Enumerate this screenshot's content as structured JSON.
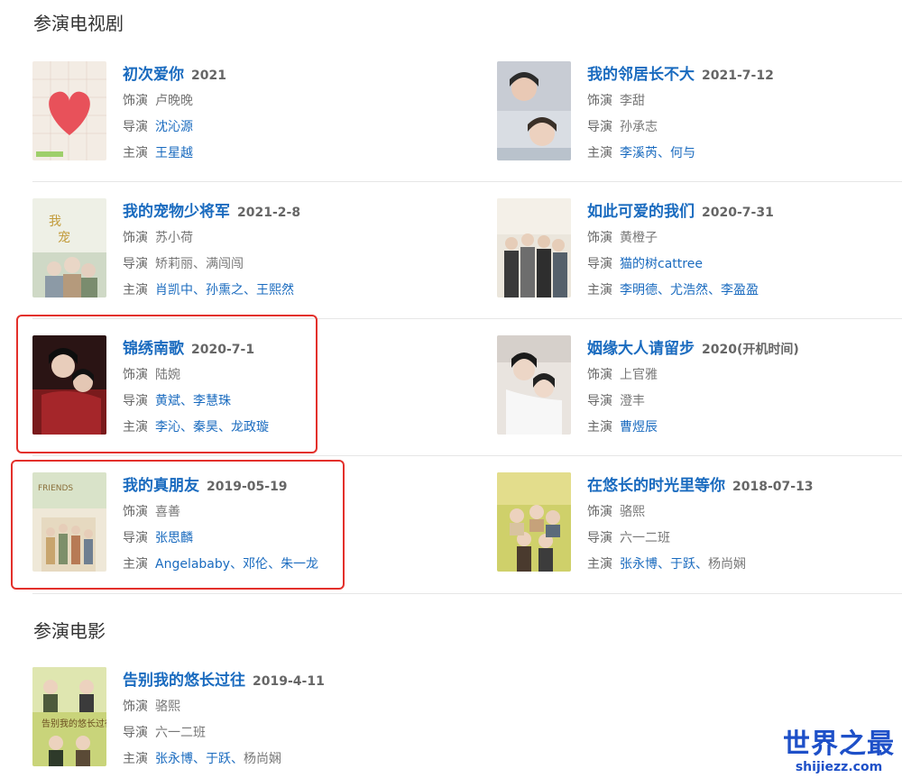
{
  "sections": {
    "tv_title": "参演电视剧",
    "movie_title": "参演电影"
  },
  "labels": {
    "role": "饰演",
    "director": "导演",
    "cast": "主演"
  },
  "tv": [
    {
      "title": "初次爱你",
      "date": "2021",
      "role": "卢晚晚",
      "director": [
        "沈沁源"
      ],
      "cast": [
        "王星越"
      ]
    },
    {
      "title": "我的邻居长不大",
      "date": "2021-7-12",
      "role": "李甜",
      "director_text": "孙承志",
      "cast": [
        "李溪芮",
        "何与"
      ]
    },
    {
      "title": "我的宠物少将军",
      "date": "2021-2-8",
      "role": "苏小荷",
      "director_text": "矫莉丽、满闯闯",
      "cast": [
        "肖凯中",
        "孙熏之",
        "王熙然"
      ]
    },
    {
      "title": "如此可爱的我们",
      "date": "2020-7-31",
      "role": "黄橙子",
      "director": [
        "猫的树cattree"
      ],
      "cast": [
        "李明德",
        "尤浩然",
        "李盈盈"
      ]
    },
    {
      "title": "锦绣南歌",
      "date": "2020-7-1",
      "role": "陆婉",
      "director": [
        "黄斌",
        "李慧珠"
      ],
      "cast": [
        "李沁",
        "秦昊",
        "龙政璇"
      ]
    },
    {
      "title": "姻缘大人请留步",
      "date": "2020(开机时间)",
      "role": "上官雅",
      "director_text": "澄丰",
      "cast": [
        "曹煜辰"
      ]
    },
    {
      "title": "我的真朋友",
      "date": "2019-05-19",
      "role": "喜善",
      "director": [
        "张思麟"
      ],
      "cast": [
        "Angelababy",
        "邓伦",
        "朱一龙"
      ]
    },
    {
      "title": "在悠长的时光里等你",
      "date": "2018-07-13",
      "role": "骆熙",
      "director_text": "六一二班",
      "cast": [
        "张永博",
        "于跃"
      ],
      "cast_plain": "杨尚娴"
    }
  ],
  "movies": [
    {
      "title": "告别我的悠长过往",
      "date": "2019-4-11",
      "role": "骆熙",
      "director_text": "六一二班",
      "cast": [
        "张永博",
        "于跃"
      ],
      "cast_plain": "杨尚娴"
    }
  ],
  "poster_text": {
    "p7": "FRIENDS",
    "p9": "告别我的悠长过往"
  },
  "watermark": {
    "cn": "世界之最",
    "en": "shijiezz.com"
  },
  "colors": {
    "link": "#1a6bbf",
    "highlight": "#e3302b",
    "watermark": "#1e50c8"
  }
}
